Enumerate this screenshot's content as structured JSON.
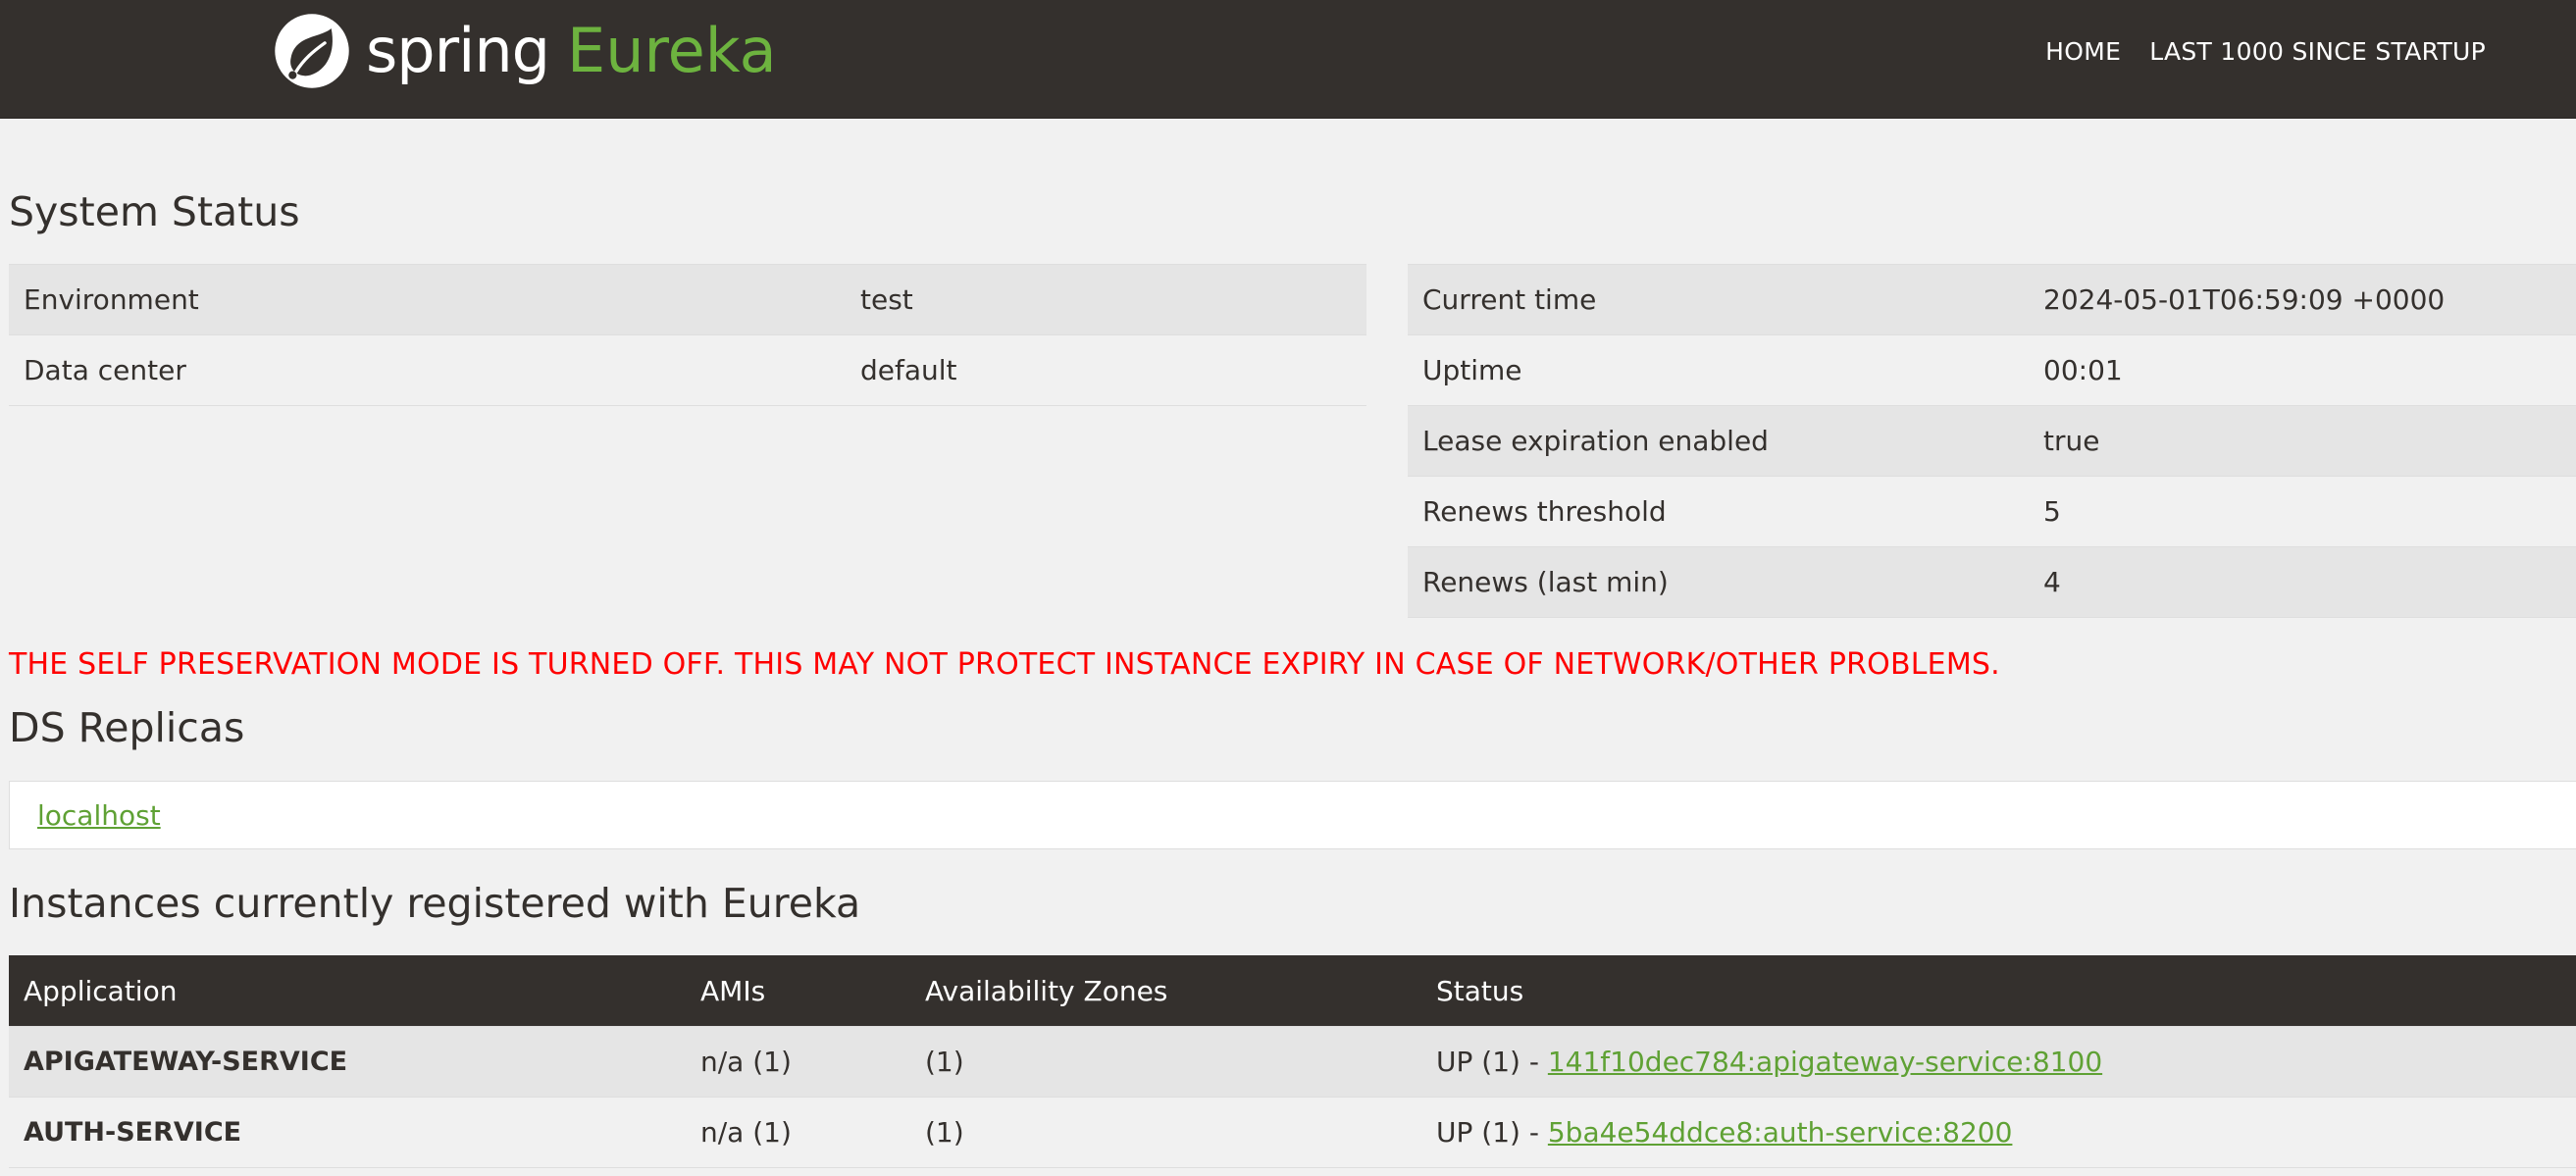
{
  "brand": {
    "spring": "spring",
    "eureka": "Eureka",
    "colors": {
      "nav_bg": "#34302d",
      "accent": "#6db33f",
      "warning": "#ff0000"
    }
  },
  "nav": {
    "home": "HOME",
    "last_1000": "LAST 1000 SINCE STARTUP"
  },
  "system_status": {
    "title": "System Status",
    "left": [
      {
        "label": "Environment",
        "value": "test"
      },
      {
        "label": "Data center",
        "value": "default"
      }
    ],
    "right": [
      {
        "label": "Current time",
        "value": "2024-05-01T06:59:09 +0000"
      },
      {
        "label": "Uptime",
        "value": "00:01"
      },
      {
        "label": "Lease expiration enabled",
        "value": "true"
      },
      {
        "label": "Renews threshold",
        "value": "5"
      },
      {
        "label": "Renews (last min)",
        "value": "4"
      }
    ]
  },
  "warning": "THE SELF PRESERVATION MODE IS TURNED OFF. THIS MAY NOT PROTECT INSTANCE EXPIRY IN CASE OF NETWORK/OTHER PROBLEMS.",
  "replicas": {
    "title": "DS Replicas",
    "items": [
      "localhost"
    ]
  },
  "instances": {
    "title": "Instances currently registered with Eureka",
    "columns": [
      "Application",
      "AMIs",
      "Availability Zones",
      "Status"
    ],
    "rows": [
      {
        "application": "APIGATEWAY-SERVICE",
        "amis": "n/a (1)",
        "zones": "(1)",
        "status_prefix": "UP (1) - ",
        "status_link": "141f10dec784:apigateway-service:8100"
      },
      {
        "application": "AUTH-SERVICE",
        "amis": "n/a (1)",
        "zones": "(1)",
        "status_prefix": "UP (1) - ",
        "status_link": "5ba4e54ddce8:auth-service:8200"
      }
    ]
  }
}
